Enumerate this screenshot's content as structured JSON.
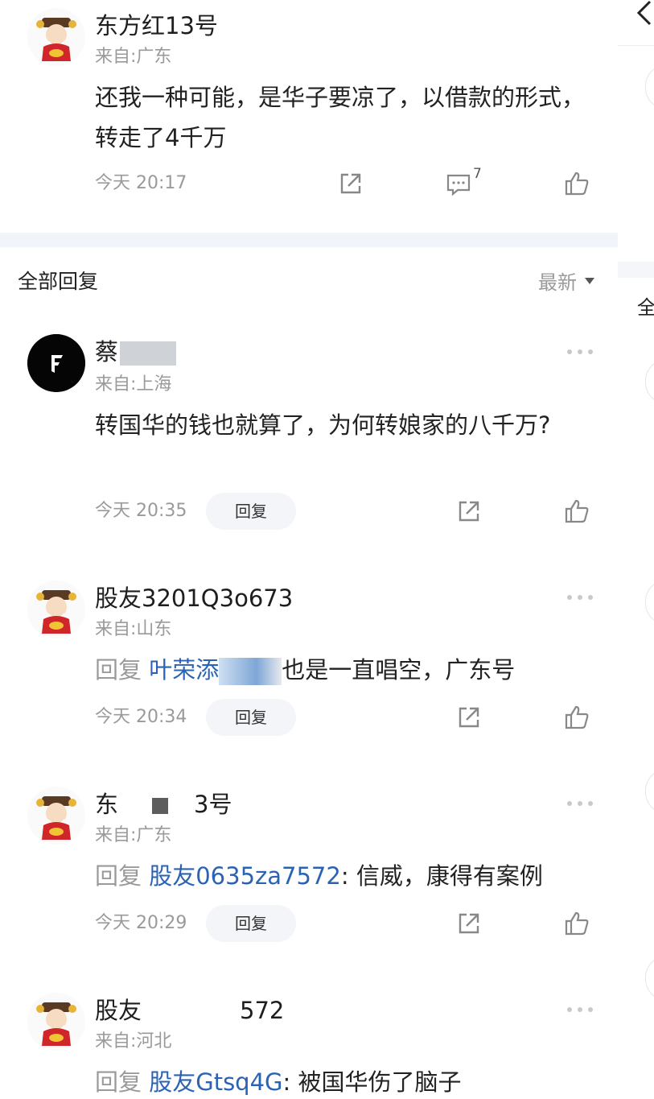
{
  "main_comment": {
    "username": "东方红13号",
    "location": "来自:广东",
    "text": "还我一种可能，是华子要凉了，以借款的形式，转走了4千万",
    "time": "今天 20:17",
    "comment_count": "7"
  },
  "section": {
    "title": "全部回复",
    "sort_label": "最新"
  },
  "replies": [
    {
      "username": "蔡",
      "location": "来自:上海",
      "text": "转国华的钱也就算了，为何转娘家的八千万?",
      "time": "今天 20:35",
      "reply_label": "回复"
    },
    {
      "username": "股友3201Q3o673",
      "location": "来自:山东",
      "reply_prefix": "回复",
      "mention": "叶荣添",
      "text": "也是一直唱空，广东号",
      "time": "今天 20:34",
      "reply_label": "回复"
    },
    {
      "username_start": "东",
      "username_end": "3号",
      "location": "来自:广东",
      "reply_prefix": "回复",
      "mention": "股友0635za7572",
      "text": ": 信威，康得有案例",
      "time": "今天 20:29",
      "reply_label": "回复"
    },
    {
      "username_start": "股友",
      "username_end": "572",
      "location": "来自:河北",
      "reply_prefix": "回复",
      "mention": "股友Gtsq4G",
      "text": ": 被国华伤了脑子"
    }
  ],
  "side_panel": {
    "section_char": "全"
  },
  "colors": {
    "mention": "#2b63b4",
    "muted": "#9a9a9a",
    "divider": "#f1f4f9"
  },
  "icons": [
    "share-icon",
    "comment-icon",
    "like-icon",
    "more-icon",
    "back-arrow-icon",
    "avatar-caishen"
  ]
}
